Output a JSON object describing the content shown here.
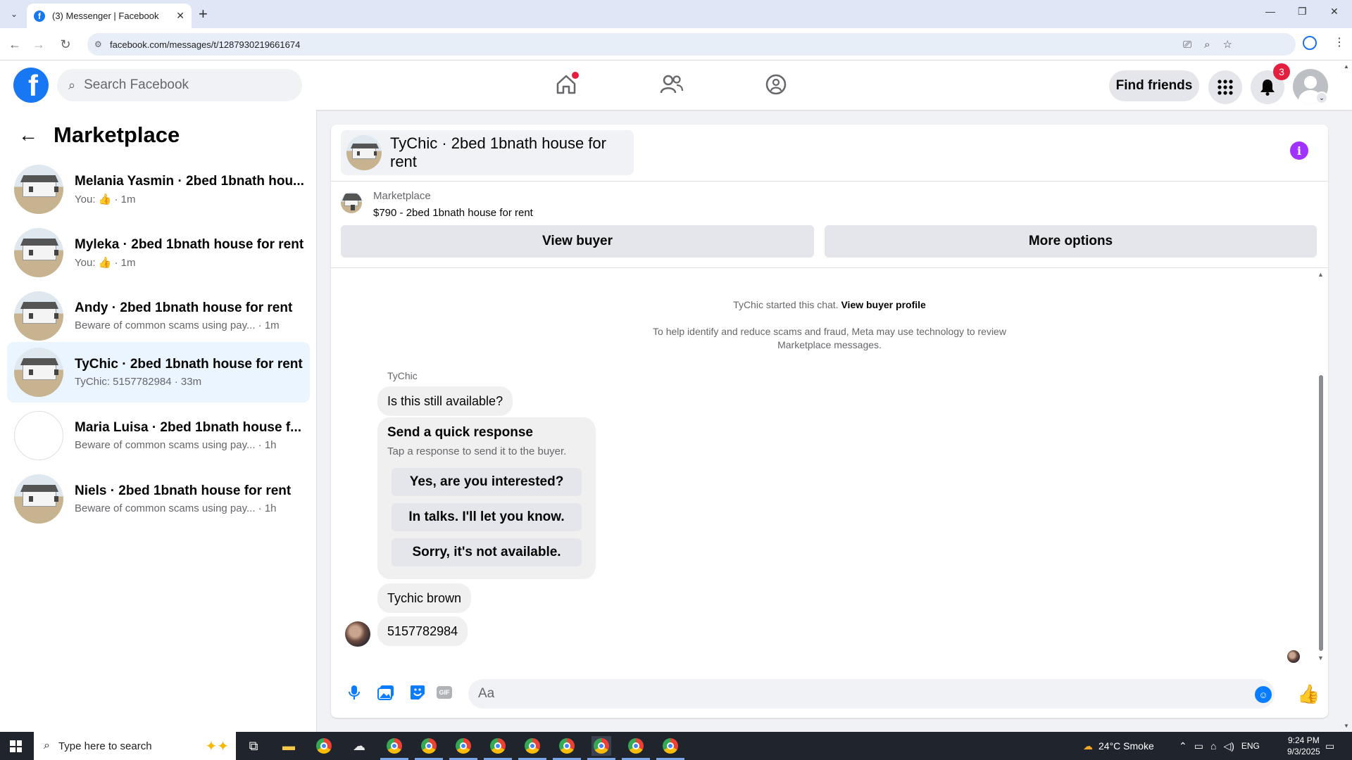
{
  "browser": {
    "tab_title": "(3) Messenger | Facebook",
    "url": "facebook.com/messages/t/1287930219661674"
  },
  "header": {
    "search_placeholder": "Search Facebook",
    "find_friends": "Find friends",
    "notification_count": "3"
  },
  "sidebar": {
    "title": "Marketplace",
    "conversations": [
      {
        "name": "Melania Yasmin · 2bed 1bnath hou...",
        "sub_prefix": "You:",
        "sub_suffix": "· 1m",
        "like": true,
        "active": false,
        "blank": false
      },
      {
        "name": "Myleka · 2bed 1bnath house for rent",
        "sub_prefix": "You:",
        "sub_suffix": "· 1m",
        "like": true,
        "active": false,
        "blank": false
      },
      {
        "name": "Andy · 2bed 1bnath house for rent",
        "sub": "Beware of common scams using pay... · 1m",
        "active": false,
        "blank": false
      },
      {
        "name": "TyChic · 2bed 1bnath house for rent",
        "sub": "TyChic: 5157782984 · 33m",
        "active": true,
        "blank": false
      },
      {
        "name": "Maria Luisa · 2bed 1bnath house f...",
        "sub": "Beware of common scams using pay... · 1h",
        "active": false,
        "blank": true
      },
      {
        "name": "Niels · 2bed 1bnath house for rent",
        "sub": "Beware of common scams using pay... · 1h",
        "active": false,
        "blank": false
      }
    ]
  },
  "chat": {
    "title": "TyChic · 2bed 1bnath house for rent",
    "listing_source": "Marketplace",
    "listing": "$790 - 2bed 1bnath house for rent",
    "view_buyer": "View buyer",
    "more_options": "More options",
    "started_text": "TyChic started this chat.",
    "view_buyer_profile": "View buyer profile",
    "scam_notice": "To help identify and reduce scams and fraud, Meta may use technology to review Marketplace messages.",
    "sender": "TyChic",
    "message1": "Is this still available?",
    "quick_title": "Send a quick response",
    "quick_sub": "Tap a response to send it to the buyer.",
    "quick_options": [
      "Yes, are you interested?",
      "In talks. I'll let you know.",
      "Sorry, it's not available."
    ],
    "message2": "Tychic brown",
    "message3": "5157782984",
    "input_placeholder": "Aa"
  },
  "taskbar": {
    "search_placeholder": "Type here to search",
    "weather": "24°C  Smoke",
    "lang": "ENG",
    "time": "9:24 PM",
    "date": "9/3/2025"
  },
  "colors": {
    "brand": "#1877f2",
    "messenger_blue": "#0a7cff",
    "info_purple": "#a033ff",
    "notification_red": "#e41e3f"
  }
}
